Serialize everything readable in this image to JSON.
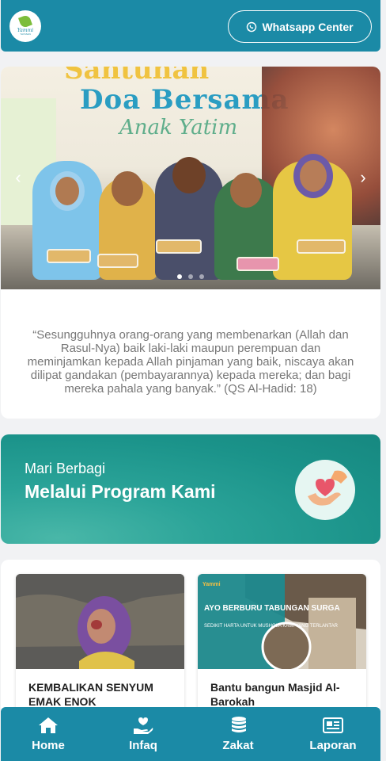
{
  "header": {
    "logo_text": "Yammi",
    "logo_sub": "YAYASAN",
    "whatsapp_label": "Whatsapp Center",
    "whatsapp_icon": "whatsapp-icon"
  },
  "hero": {
    "banner_line1": "Santunan",
    "banner_line2": "Doa Bersama",
    "banner_line3": "Anak Yatim",
    "quote": "“Sesungguhnya orang-orang yang membenarkan (Allah dan Rasul-Nya) baik laki-laki maupun perempuan dan meminjamkan kepada Allah pinjaman yang baik, niscaya akan dilipat gandakan (pembayarannya) kepada mereka; dan bagi mereka pahala yang banyak.” (QS Al-Hadid: 18)"
  },
  "program_banner": {
    "line1": "Mari Berbagi",
    "line2": "Melalui Program Kami",
    "icon": "heart-hands-icon"
  },
  "programs": [
    {
      "title": "KEMBALIKAN SENYUM EMAK ENOK"
    },
    {
      "title": "Bantu bangun Masjid Al-Barokah",
      "image_brand": "Yammi",
      "image_headline": "AYO BERBURU TABUNGAN SURGA",
      "image_caption": "SEDIKIT HARTA UNTUK MUSHOLA KAMI YANG TERLANTAR"
    }
  ],
  "nav": {
    "items": [
      {
        "label": "Home",
        "icon": "home-icon"
      },
      {
        "label": "Infaq",
        "icon": "hand-heart-icon"
      },
      {
        "label": "Zakat",
        "icon": "coins-icon"
      },
      {
        "label": "Laporan",
        "icon": "newspaper-icon"
      }
    ]
  },
  "colors": {
    "primary": "#1b8aa6",
    "program_banner": "#1b938a"
  }
}
